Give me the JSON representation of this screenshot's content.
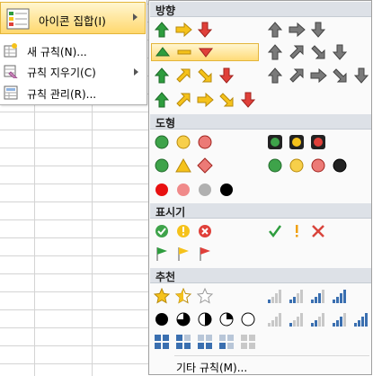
{
  "left_menu": {
    "icon_sets": {
      "label": "아이콘 집합(I)"
    },
    "new_rule": {
      "label": "새 규칙(N)..."
    },
    "clear_rules": {
      "label": "규칙 지우기(C)"
    },
    "manage_rules": {
      "label": "규칙 관리(R)..."
    }
  },
  "sections": {
    "directional": "방향",
    "shapes": "도형",
    "indicators": "표시기",
    "ratings": "추천"
  },
  "more_rules": "기타 규칙(M)...",
  "colors": {
    "green": "#2e9d3e",
    "yellow": "#f5c21b",
    "red": "#e0403a",
    "gray": "#7a7a7a",
    "blue": "#3a6fb0",
    "highlight": "#ffdb78"
  }
}
